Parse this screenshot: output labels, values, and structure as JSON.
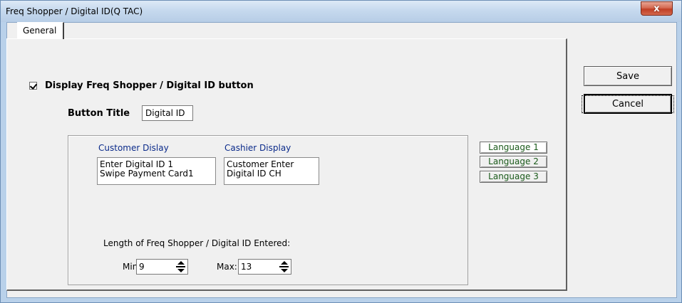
{
  "window": {
    "title": "Freq Shopper / Digital ID(Q TAC)",
    "close_glyph": "x"
  },
  "tabs": [
    {
      "label": "General",
      "selected": true
    }
  ],
  "display_button": {
    "checked": true,
    "label": "Display Freq Shopper / Digital ID button"
  },
  "button_title": {
    "label": "Button Title",
    "value": "Digital ID"
  },
  "customer_display": {
    "header": "Customer Dislay",
    "text": "Enter Digital ID 1\nSwipe Payment Card1"
  },
  "cashier_display": {
    "header": "Cashier Display",
    "text": "Customer Enter\nDigital ID CH"
  },
  "languages": [
    {
      "label": "Language 1",
      "selected": true
    },
    {
      "label": "Language 2",
      "selected": false
    },
    {
      "label": "Language 3",
      "selected": false
    }
  ],
  "length": {
    "label": "Length of Freq Shopper / Digital ID Entered:",
    "min_label": "Min:",
    "min_value": "9",
    "max_label": "Max:",
    "max_value": "13"
  },
  "actions": {
    "save_label": "Save",
    "cancel_label": "Cancel"
  },
  "colors": {
    "header_blue": "#0a2a8a",
    "language_green": "#1a5a1a",
    "close_red": "#c13f25"
  }
}
